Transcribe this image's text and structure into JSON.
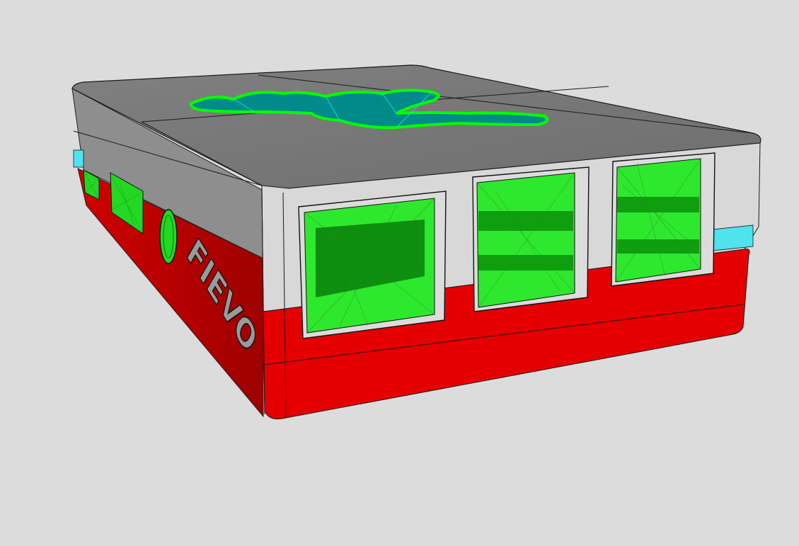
{
  "scene": {
    "embossed_text": "FIEVO",
    "colors": {
      "background": "#dcdcdc",
      "top_lid": "#7a7a7a",
      "top_lid_light": "#8a8a8a",
      "upper_band": "#d6d6d6",
      "lower_shell": "#e00000",
      "lower_shell_dark": "#b80000",
      "port_fill": "#22e022",
      "port_fill_dark": "#0a8a0a",
      "logo_outline": "#00ff00",
      "logo_fill": "#008a8a",
      "accent_cyan": "#4fe3ee"
    },
    "front_ports": [
      {
        "name": "usb-port-1"
      },
      {
        "name": "usb-port-2"
      },
      {
        "name": "ethernet-port"
      }
    ],
    "side_openings": [
      {
        "name": "side-port-1"
      },
      {
        "name": "side-port-2"
      },
      {
        "name": "side-round-hole"
      }
    ]
  }
}
